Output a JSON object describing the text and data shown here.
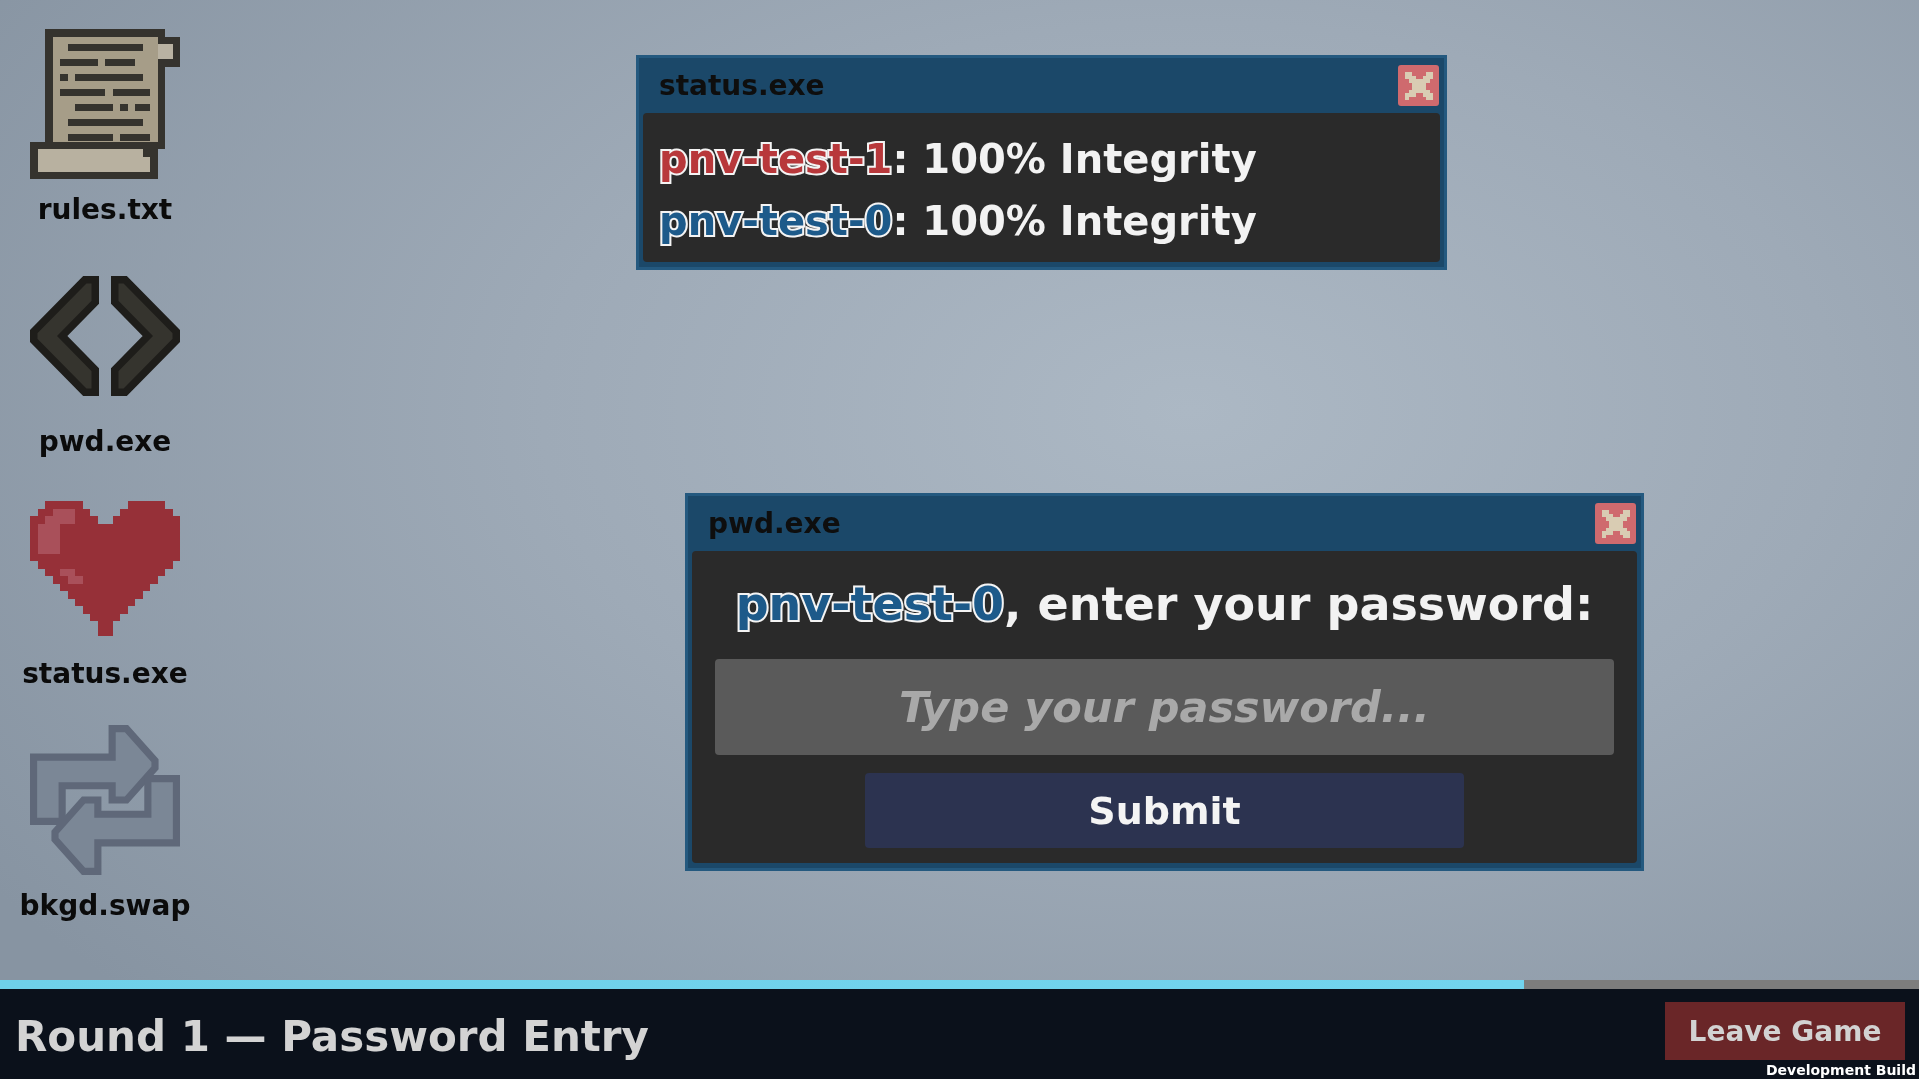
{
  "desktop_icons": [
    {
      "label": "rules.txt",
      "kind": "scroll"
    },
    {
      "label": "pwd.exe",
      "kind": "code"
    },
    {
      "label": "status.exe",
      "kind": "heart"
    },
    {
      "label": "bkgd.swap",
      "kind": "swap"
    }
  ],
  "status_window": {
    "title": "status.exe",
    "players": [
      {
        "name": "pnv-test-1",
        "color": "#b8383b",
        "rest": ": 100% Integrity"
      },
      {
        "name": "pnv-test-0",
        "color": "#1d5a8a",
        "rest": ": 100% Integrity"
      }
    ]
  },
  "password_window": {
    "title": "pwd.exe",
    "prompt": {
      "name": "pnv-test-0",
      "color": "#1d5a8a",
      "rest": ", enter your password:"
    },
    "field": {
      "placeholder": "Type your password..."
    },
    "submit_button": "Submit"
  },
  "bottom_bar": {
    "progress": {
      "level": 0.794
    },
    "title": "Round 1 — Password Entry",
    "leave_button": "Leave Game",
    "build_label": "Development Build"
  }
}
